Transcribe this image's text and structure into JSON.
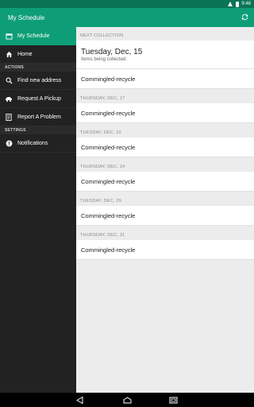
{
  "status": {
    "time": "9:48"
  },
  "appbar": {
    "title": "My Schedule"
  },
  "sidebar": {
    "items_top": [
      {
        "label": "My Schedule",
        "icon": "calendar-icon",
        "active": true
      },
      {
        "label": "Home",
        "icon": "home-icon",
        "active": false
      }
    ],
    "actions_header": "ACTIONS",
    "actions": [
      {
        "label": "Find new address",
        "icon": "search-location-icon"
      },
      {
        "label": "Request A Pickup",
        "icon": "truck-icon"
      },
      {
        "label": "Report A Problem",
        "icon": "report-icon"
      }
    ],
    "settings_header": "SETTINGS",
    "settings": [
      {
        "label": "Notifications",
        "icon": "notification-icon"
      }
    ]
  },
  "schedule": {
    "next_header": "NEXT COLLECTION",
    "next_date": "Tuesday, Dec, 15",
    "next_sub": "Items being collected:",
    "next_item": "Commingled-recycle",
    "entries": [
      {
        "date": "THURSDAY, DEC, 17",
        "item": "Commingled-recycle"
      },
      {
        "date": "TUESDAY, DEC, 22",
        "item": "Commingled-recycle"
      },
      {
        "date": "THURSDAY, DEC, 24",
        "item": "Commingled-recycle"
      },
      {
        "date": "TUESDAY, DEC, 29",
        "item": "Commingled-recycle"
      },
      {
        "date": "THURSDAY, DEC, 31",
        "item": "Commingled-recycle"
      }
    ]
  },
  "colors": {
    "accent": "#0e9e77",
    "statusbar": "#0a7355",
    "sidebar": "#222222"
  },
  "nav": {
    "icons": [
      "back-icon",
      "home-nav-icon",
      "recents-icon"
    ]
  }
}
